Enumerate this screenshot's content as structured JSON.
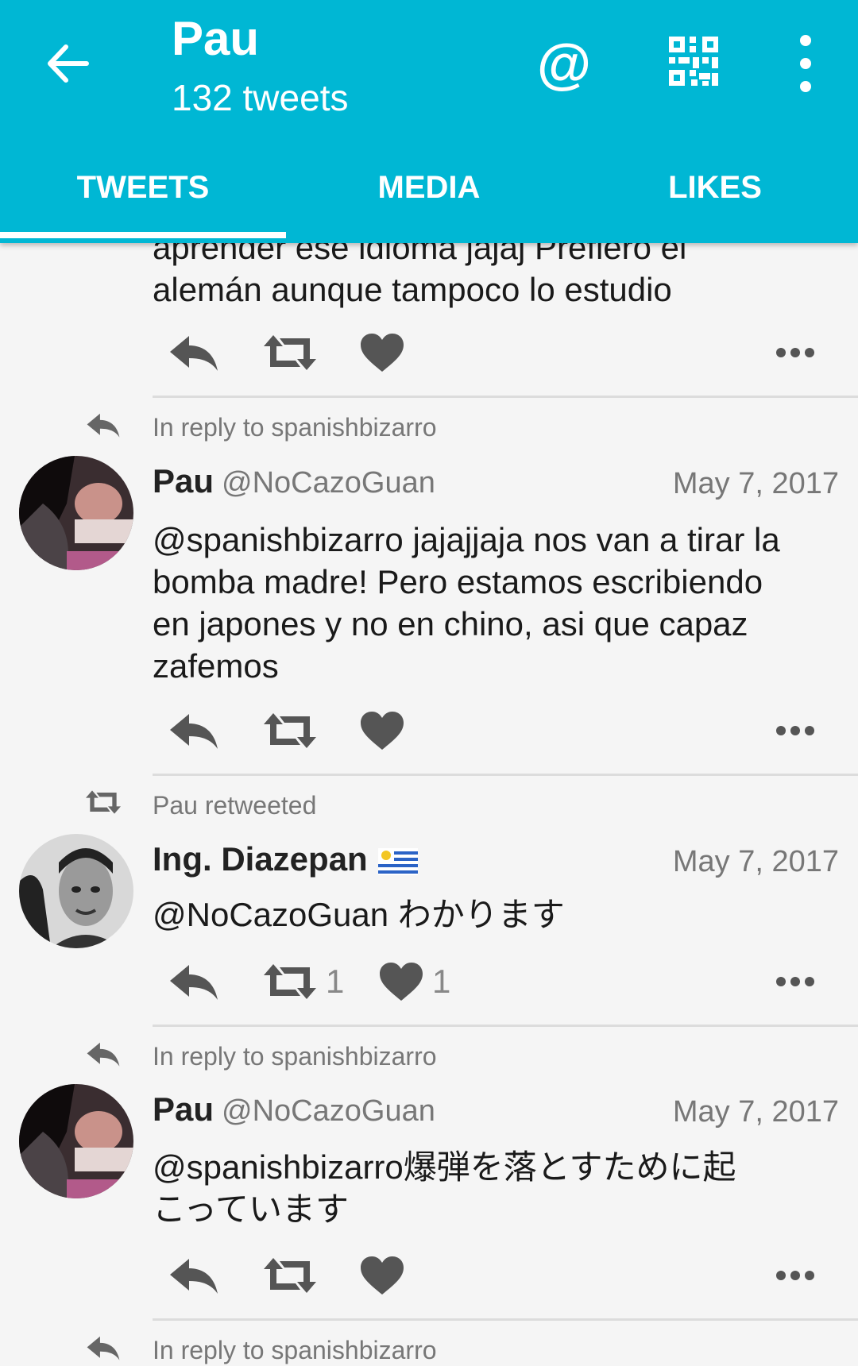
{
  "header": {
    "title": "Pau",
    "subtitle": "132 tweets",
    "mention_icon": "@",
    "tabs": [
      {
        "label": "TWEETS",
        "active": true
      },
      {
        "label": "MEDIA",
        "active": false
      },
      {
        "label": "LIKES",
        "active": false
      }
    ],
    "color": "#00b7d4"
  },
  "partial_tweet": {
    "text_line1": "aprender ese idioma jajaj Prefiero el",
    "text_line2": "alemán aunque tampoco lo estudio"
  },
  "tweets": [
    {
      "context": "In reply to spanishbizarro",
      "context_icon": "reply-icon",
      "name": "Pau",
      "handle": "@NoCazoGuan",
      "date": "May 7, 2017",
      "text": [
        "@spanishbizarro jajajjaja nos van a tirar la",
        "bomba madre! Pero estamos escribiendo",
        "en japones y no en chino, asi que capaz",
        "zafemos"
      ]
    },
    {
      "context": "Pau retweeted",
      "context_icon": "retweet-icon",
      "name": "Ing. Diazepan",
      "name_flag": "uruguay-flag-icon",
      "handle": "",
      "date": "May 7, 2017",
      "text": [
        "@NoCazoGuan わかります"
      ],
      "retweets": "1",
      "likes": "1"
    },
    {
      "context": "In reply to spanishbizarro",
      "context_icon": "reply-icon",
      "name": "Pau",
      "handle": "@NoCazoGuan",
      "date": "May 7, 2017",
      "text": [
        "@spanishbizarro爆弾を落とすために起",
        "こっています"
      ]
    }
  ],
  "partial_bottom_context": "In reply to spanishbizarro"
}
